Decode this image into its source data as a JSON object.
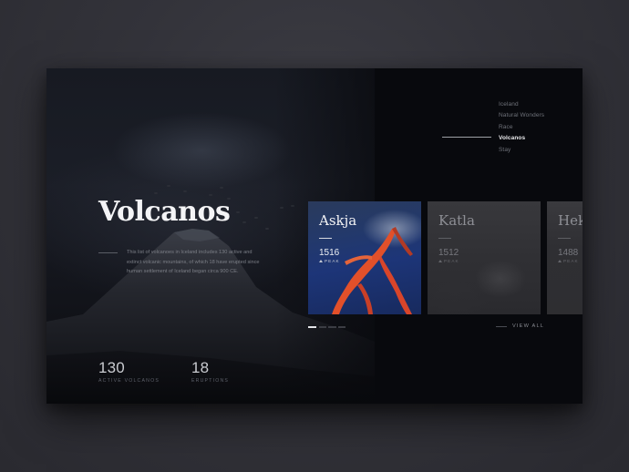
{
  "nav": {
    "items": [
      {
        "label": "Iceland"
      },
      {
        "label": "Natural Wonders"
      },
      {
        "label": "Race"
      },
      {
        "label": "Volcanos"
      },
      {
        "label": "Stay"
      }
    ],
    "active_index": 3
  },
  "hero": {
    "title": "Volcanos",
    "description": "This list of volcanoes in Iceland includes 130 active and extinct volcanic mountains, of which 18 have erupted since human settlement of Iceland began circa 900 CE."
  },
  "stats": [
    {
      "value": "130",
      "label": "ACTIVE VOLCANOS"
    },
    {
      "value": "18",
      "label": "ERUPTIONS"
    }
  ],
  "volcanoes": [
    {
      "name": "Askja",
      "peak": "1516",
      "peak_label": "PEAK",
      "active": true
    },
    {
      "name": "Katla",
      "peak": "1512",
      "peak_label": "PEAK",
      "active": false
    },
    {
      "name": "Hekla",
      "peak": "1488",
      "peak_label": "PEAK",
      "active": false
    }
  ],
  "carousel": {
    "pages": 4,
    "current": 1
  },
  "view_all_label": "VIEW ALL",
  "colors": {
    "background": "#33333a",
    "card": "#08090d",
    "lava": "#e2502a",
    "accent_text": "#f4f4f6"
  }
}
